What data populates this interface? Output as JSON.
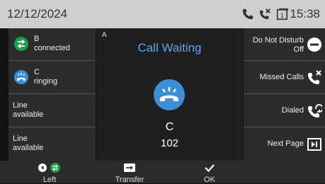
{
  "topbar": {
    "date": "12/12/2024",
    "time": "15:38"
  },
  "lines": [
    {
      "name": "B",
      "state": "connected",
      "icon": "transfer-arrows-icon",
      "color": "#1e9e4a"
    },
    {
      "name": "C",
      "state": "ringing",
      "icon": "ringing-phone-icon",
      "color": "#3a8fd8"
    },
    {
      "name": "Line",
      "state": "available"
    },
    {
      "name": "Line",
      "state": "available"
    }
  ],
  "call": {
    "tag": "A",
    "title": "Call Waiting",
    "caller_name": "C",
    "caller_number": "102",
    "accent": "#5aa7e8"
  },
  "right_keys": {
    "dnd_line1": "Do Not Disturb",
    "dnd_line2": "Off",
    "missed": "Missed Calls",
    "dialed": "Dialed",
    "next": "Next Page"
  },
  "softkeys": {
    "left": "Left",
    "transfer": "Transfer",
    "ok": "OK"
  }
}
